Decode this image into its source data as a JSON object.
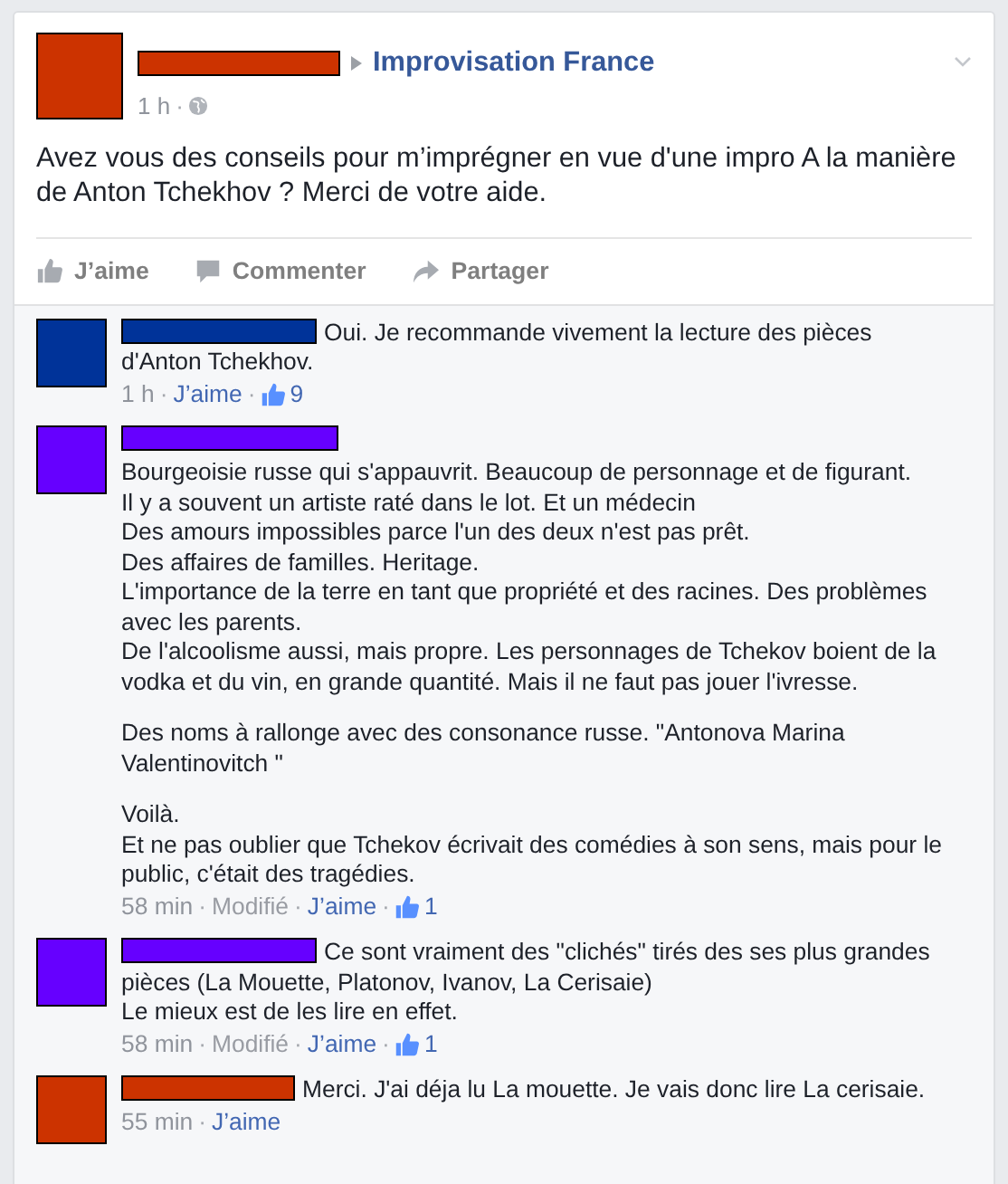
{
  "post": {
    "group": "Improvisation France",
    "meta": [
      {
        "kind": "time",
        "text": "1 h"
      },
      {
        "kind": "sep",
        "text": "·"
      }
    ],
    "text": "Avez vous des conseils pour m’imprégner en vue d'une impro A la manière de Anton Tchekhov ? Merci de votre aide.",
    "actions": [
      {
        "kind": "like",
        "label": "J’aime"
      },
      {
        "kind": "comment",
        "label": "Commenter"
      },
      {
        "kind": "share",
        "label": "Partager"
      }
    ]
  },
  "comments": [
    {
      "color": "#003399",
      "name_inline": true,
      "paragraphs": [
        "Oui. Je recommande vivement la lecture des pièces d'Anton Tchekhov."
      ],
      "meta": [
        {
          "kind": "time",
          "text": "1 h"
        },
        {
          "kind": "sep",
          "text": "·"
        },
        {
          "kind": "like",
          "text": "J’aime"
        },
        {
          "kind": "sep",
          "text": "·"
        },
        {
          "kind": "likes",
          "text": "9"
        }
      ]
    },
    {
      "color": "#6600ff",
      "name_inline": false,
      "paragraphs": [
        "Bourgeoisie russe qui s'appauvrit. Beaucoup de personnage et de figurant.\nIl y a souvent un artiste raté dans le lot. Et un médecin\nDes amours impossibles parce l'un des deux n'est pas prêt.\nDes affaires de familles. Heritage.\nL'importance de la terre en tant que propriété et des racines. Des problèmes avec les parents.\nDe l'alcoolisme aussi, mais propre. Les personnages de Tchekov boient de la vodka et du vin, en grande quantité. Mais il ne faut pas jouer l'ivresse.",
        "Des noms à rallonge avec des consonance russe. \"Antonova Marina Valentinovitch \"",
        "Voilà.\nEt ne pas oublier que Tchekov écrivait des comédies à son sens, mais pour le public, c'était des tragédies."
      ],
      "meta": [
        {
          "kind": "time",
          "text": "58 min"
        },
        {
          "kind": "sep",
          "text": "·"
        },
        {
          "kind": "edited",
          "text": "Modifié"
        },
        {
          "kind": "sep",
          "text": "·"
        },
        {
          "kind": "like",
          "text": "J’aime"
        },
        {
          "kind": "sep",
          "text": "·"
        },
        {
          "kind": "likes",
          "text": "1"
        }
      ]
    },
    {
      "color": "#6600ff",
      "name_inline": true,
      "paragraphs": [
        "Ce sont vraiment des \"clichés\" tirés des ses plus grandes pièces (La Mouette, Platonov, Ivanov, La Cerisaie)\nLe mieux est de les lire en effet."
      ],
      "meta": [
        {
          "kind": "time",
          "text": "58 min"
        },
        {
          "kind": "sep",
          "text": "·"
        },
        {
          "kind": "edited",
          "text": "Modifié"
        },
        {
          "kind": "sep",
          "text": "·"
        },
        {
          "kind": "like",
          "text": "J’aime"
        },
        {
          "kind": "sep",
          "text": "·"
        },
        {
          "kind": "likes",
          "text": "1"
        }
      ]
    },
    {
      "color": "#cc3300",
      "name_inline": true,
      "paragraphs": [
        "Merci. J'ai déja lu La mouette. Je vais donc lire La cerisaie."
      ],
      "meta": [
        {
          "kind": "time",
          "text": "55 min"
        },
        {
          "kind": "sep",
          "text": "·"
        },
        {
          "kind": "like",
          "text": "J’aime"
        }
      ]
    }
  ]
}
